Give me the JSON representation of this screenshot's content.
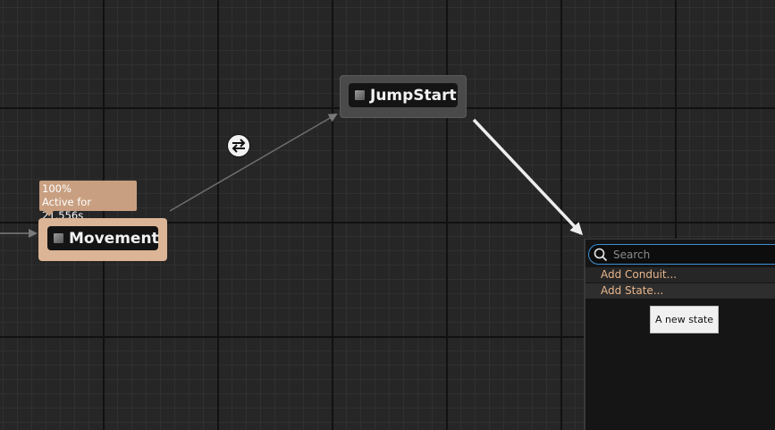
{
  "graph": {
    "states": {
      "jumpstart": {
        "label": "JumpStart"
      },
      "movement": {
        "label": "Movement"
      }
    },
    "active_tooltip": {
      "weight": "100%",
      "active_time": "Active for 21.556s"
    },
    "icons": {
      "state": "state-node-icon",
      "transition": "transition-rule-icon",
      "search": "search-icon"
    },
    "colors": {
      "canvas": "#262626",
      "active_state": "#dbb596",
      "state_body": "#141414",
      "menu_text": "#e8b58c",
      "search_focus": "#3c8fd4"
    }
  },
  "context_menu": {
    "search_placeholder": "Search",
    "items": [
      {
        "label": "Add Conduit..."
      },
      {
        "label": "Add State..."
      }
    ],
    "tooltip": "A new state"
  }
}
